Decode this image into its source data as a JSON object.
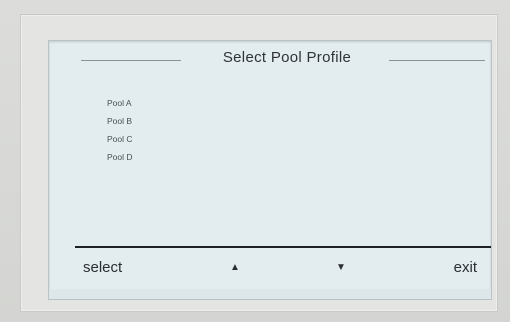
{
  "dialog": {
    "title": "Select   Pool   Profile"
  },
  "pools": [
    {
      "label": "Pool A"
    },
    {
      "label": "Pool B"
    },
    {
      "label": "Pool C"
    },
    {
      "label": "Pool D"
    }
  ],
  "softkeys": {
    "select_label": "select",
    "up_icon": "▲",
    "down_icon": "▼",
    "exit_label": "exit"
  }
}
